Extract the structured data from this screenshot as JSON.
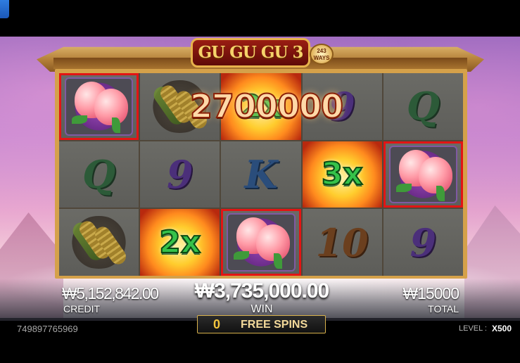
{
  "game": {
    "logo_text": "GU GU GU 3",
    "ways_badge": "243 WAYS"
  },
  "reels": {
    "rows": [
      [
        {
          "symbol": "peach",
          "win": true
        },
        {
          "symbol": "corn",
          "win": false
        },
        {
          "symbol": "wild",
          "label": "2x",
          "win": true
        },
        {
          "symbol": "9",
          "win": false
        },
        {
          "symbol": "Q",
          "win": false
        }
      ],
      [
        {
          "symbol": "Q",
          "win": false
        },
        {
          "symbol": "9",
          "win": false
        },
        {
          "symbol": "K",
          "win": false
        },
        {
          "symbol": "wild",
          "label": "3x",
          "win": true
        },
        {
          "symbol": "peach",
          "win": true
        }
      ],
      [
        {
          "symbol": "corn",
          "win": false
        },
        {
          "symbol": "wild",
          "label": "2x",
          "win": true
        },
        {
          "symbol": "peach",
          "win": true
        },
        {
          "symbol": "10",
          "win": false
        },
        {
          "symbol": "9",
          "win": false
        }
      ]
    ]
  },
  "win_popup": "2700000",
  "hud": {
    "credit_value": "₩5,152,842.00",
    "credit_label": "CREDIT",
    "win_value": "₩3,735,000.00",
    "win_label": "WIN",
    "total_value": "₩15000",
    "total_label": "TOTAL"
  },
  "footer": {
    "session_id": "749897765969",
    "free_spins_count": "0",
    "free_spins_label": "FREE SPINS",
    "level_label": "LEVEL :",
    "level_value": "X500"
  },
  "colors": {
    "win_outline": "#e31414",
    "free_spins_border": "#d9b24c",
    "wild_multiplier": "#35c24a"
  }
}
